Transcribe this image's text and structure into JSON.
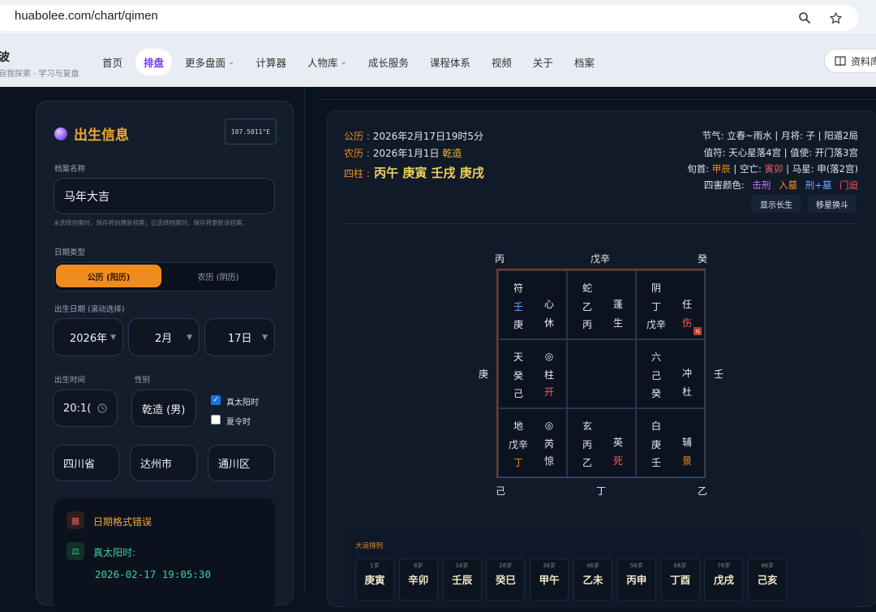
{
  "browser": {
    "url": "huabolee.com/chart/qimen"
  },
  "site": {
    "brand_title": "波",
    "brand_sub": "自我探索 · 学习与复盘",
    "nav": [
      {
        "label": "首页",
        "caret": false
      },
      {
        "label": "排盘",
        "caret": false,
        "active": true
      },
      {
        "label": "更多盘面",
        "caret": true
      },
      {
        "label": "计算器",
        "caret": false
      },
      {
        "label": "人物库",
        "caret": true
      },
      {
        "label": "成长服务",
        "caret": false
      },
      {
        "label": "课程体系",
        "caret": false
      },
      {
        "label": "视频",
        "caret": false
      },
      {
        "label": "关于",
        "caret": false
      },
      {
        "label": "档案",
        "caret": false
      }
    ],
    "docs_button": "资料库"
  },
  "form": {
    "title": "出生信息",
    "longitude": "107.5011°E",
    "archive_label": "档案名称",
    "archive_value": "马年大吉",
    "archive_hint": "未选择档案时，保存将创建新档案；已选择档案时，保存将更新该档案。",
    "date_type_label": "日期类型",
    "date_solar": "公历 (阳历)",
    "date_lunar": "农历 (阴历)",
    "birth_date_label": "出生日期 (滚动选择)",
    "year": "2026年",
    "month": "2月",
    "day": "17日",
    "birth_time_label": "出生时间",
    "time_value": "20:1(",
    "gender_label": "性别",
    "gender_value": "乾造 (男)",
    "true_solar_label": "真太阳时",
    "dst_label": "夏令时",
    "province": "四川省",
    "city": "达州市",
    "district": "通川区",
    "error_title": "日期格式错误",
    "true_solar_title": "真太阳时:",
    "true_solar_time": "2026-02-17 19:05:30"
  },
  "chart": {
    "solar_key": "公历 :",
    "solar_val": "2026年2月17日19时5分",
    "lunar_key": "农历 :",
    "lunar_val": "2026年1月1日",
    "lunar_gender": "乾造",
    "pillars_key": "四柱 :",
    "pillars_val": "丙午 庚寅 壬戌 庚戌",
    "r1": "节气: 立春~雨水 | 月将: 子 | 阳遁2局",
    "r2": "值符: 天心星落4宫 | 值使: 开门落3宫",
    "r3_a": "旬首:",
    "r3_b": "甲辰",
    "r3_c": "| 空亡:",
    "r3_d": "寅卯",
    "r3_e": "| 马星: 申(落2宫)",
    "r4_a": "四害颜色:",
    "r4_b": "击刑",
    "r4_c": "入墓",
    "r4_d": "刑+墓",
    "r4_e": "门迫",
    "btn_show": "显示长生",
    "btn_move": "移星换斗",
    "outer": {
      "top_left": "丙",
      "top_mid": "戊辛",
      "top_right": "癸",
      "left": "庚",
      "right": "壬",
      "bot_left": "己",
      "bot_mid": "丁",
      "bot_right": "乙"
    },
    "cells": {
      "c1": {
        "a": "符",
        "b": "壬",
        "c": "庚",
        "d": "心",
        "e": "休"
      },
      "c2": {
        "a": "蛇",
        "b": "乙",
        "c": "丙",
        "d": "蓬",
        "e": "生"
      },
      "c3": {
        "a": "阴",
        "b": "丁",
        "c": "戊辛",
        "d": "任",
        "e": "伤",
        "tag": "马"
      },
      "c4": {
        "a": "天",
        "b": "癸",
        "c": "己",
        "d": "◎",
        "e": "柱",
        "f": "开"
      },
      "c6": {
        "a": "六",
        "b": "己",
        "c": "癸",
        "d": "冲",
        "e": "杜"
      },
      "c7": {
        "a": "地",
        "b": "戊辛",
        "c": "丁",
        "d": "◎",
        "e": "芮",
        "f": "惊"
      },
      "c8": {
        "a": "玄",
        "b": "丙",
        "c": "乙",
        "d": "英",
        "e": "死"
      },
      "c9": {
        "a": "白",
        "b": "庚",
        "c": "壬",
        "d": "辅",
        "e": "景"
      }
    },
    "dayun_title": "大运排列",
    "dayun": [
      {
        "age": "1岁",
        "gz": "庚寅"
      },
      {
        "age": "6岁",
        "gz": "辛卯"
      },
      {
        "age": "16岁",
        "gz": "壬辰"
      },
      {
        "age": "26岁",
        "gz": "癸巳"
      },
      {
        "age": "36岁",
        "gz": "甲午"
      },
      {
        "age": "46岁",
        "gz": "乙未"
      },
      {
        "age": "56岁",
        "gz": "丙申"
      },
      {
        "age": "66岁",
        "gz": "丁酉"
      },
      {
        "age": "76岁",
        "gz": "戊戌"
      },
      {
        "age": "86岁",
        "gz": "己亥"
      }
    ]
  }
}
